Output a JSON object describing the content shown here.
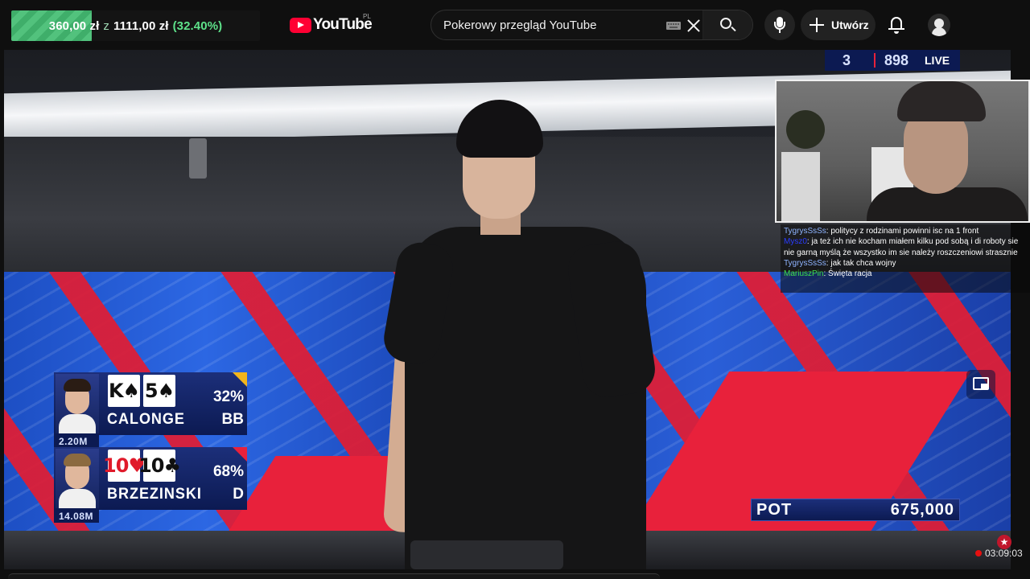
{
  "goal_widget": {
    "current": "360,00 zł",
    "separator": "z",
    "target": "1111,00 zł",
    "percent_text": "(32.40%)",
    "progress": 0.324,
    "fill_color": "#52c27d"
  },
  "youtube": {
    "logo_text": "YouTube",
    "region": "PL",
    "search_value": "Pokerowy przegląd YouTube",
    "create_label": "Utwórz",
    "icons": [
      "keyboard-icon",
      "clear-icon",
      "search-icon",
      "mic-icon",
      "plus-icon",
      "bell-icon",
      "avatar"
    ]
  },
  "broadcast": {
    "live_strip": {
      "num1": "3",
      "num2": "898",
      "live": "LIVE"
    },
    "players": [
      {
        "name": "CALONGE",
        "card1": "K♠",
        "card2": "5♠",
        "equity": "32%",
        "position": "BB",
        "stack": "2.20M"
      },
      {
        "name": "BRZEZINSKI",
        "card1": "10♥",
        "card2": "10♣",
        "equity": "68%",
        "position": "D",
        "stack": "14.08M"
      }
    ],
    "pot": {
      "label": "POT",
      "value": "675,000"
    }
  },
  "chat": {
    "messages": [
      {
        "user": "TygrysSsSs",
        "user_color": "#8fb4ff",
        "text": ": politycy z rodzinami powinni isc na 1 front"
      },
      {
        "user": "Mysz0",
        "user_color": "#2a3cff",
        "text": ": ja też ich nie kocham miałem kilku pod sobą i di roboty sie nie garną myślą że wszystko im sie należy roszczeniowi strasznie"
      },
      {
        "user": "TygrysSsSs",
        "user_color": "#8fb4ff",
        "text": ": jak tak chca wojny"
      },
      {
        "user": "MariuszPin",
        "user_color": "#3de04a",
        "text": ": Święta racja"
      }
    ]
  },
  "recording": {
    "time": "03:09:03",
    "dot_color": "#e51010"
  }
}
